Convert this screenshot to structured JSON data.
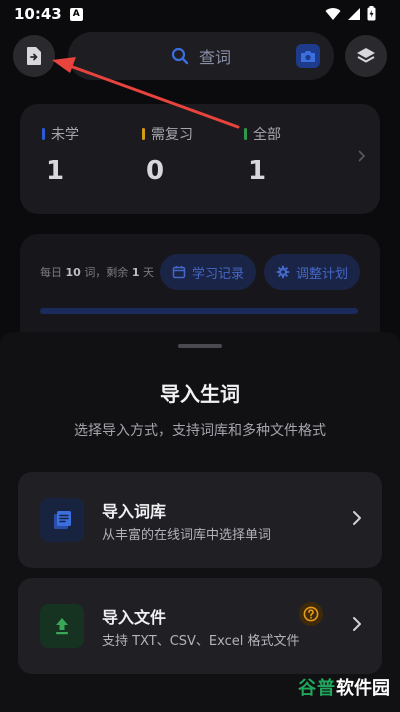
{
  "status_bar": {
    "time": "10:43",
    "badge_letter": "A"
  },
  "search": {
    "placeholder": "查词"
  },
  "stats": {
    "items": [
      {
        "label": "未学",
        "value": "1",
        "color": "#2b5bd7"
      },
      {
        "label": "需复习",
        "value": "0",
        "color": "#d49a1a"
      },
      {
        "label": "全部",
        "value": "1",
        "color": "#2e9a4e"
      }
    ]
  },
  "plan": {
    "daily_prefix": "每日",
    "daily_count": "10",
    "daily_mid": "词，剩余",
    "days_left": "1",
    "daily_suffix": "天",
    "study_record_label": "学习记录",
    "adjust_plan_label": "调整计划"
  },
  "sheet": {
    "title": "导入生词",
    "subtitle": "选择导入方式，支持词库和多种文件格式",
    "options": [
      {
        "title": "导入词库",
        "description": "从丰富的在线词库中选择单词",
        "icon": "book-list-icon",
        "accent": "#2a4ea8"
      },
      {
        "title": "导入文件",
        "description": "支持 TXT、CSV、Excel 格式文件",
        "icon": "upload-icon",
        "accent": "#3aa657"
      }
    ]
  },
  "watermark": {
    "first": "谷",
    "second": "普",
    "rest": "软件园"
  },
  "colors": {
    "accent_blue": "#3b6fe0",
    "annotation_red": "#e8433c"
  }
}
